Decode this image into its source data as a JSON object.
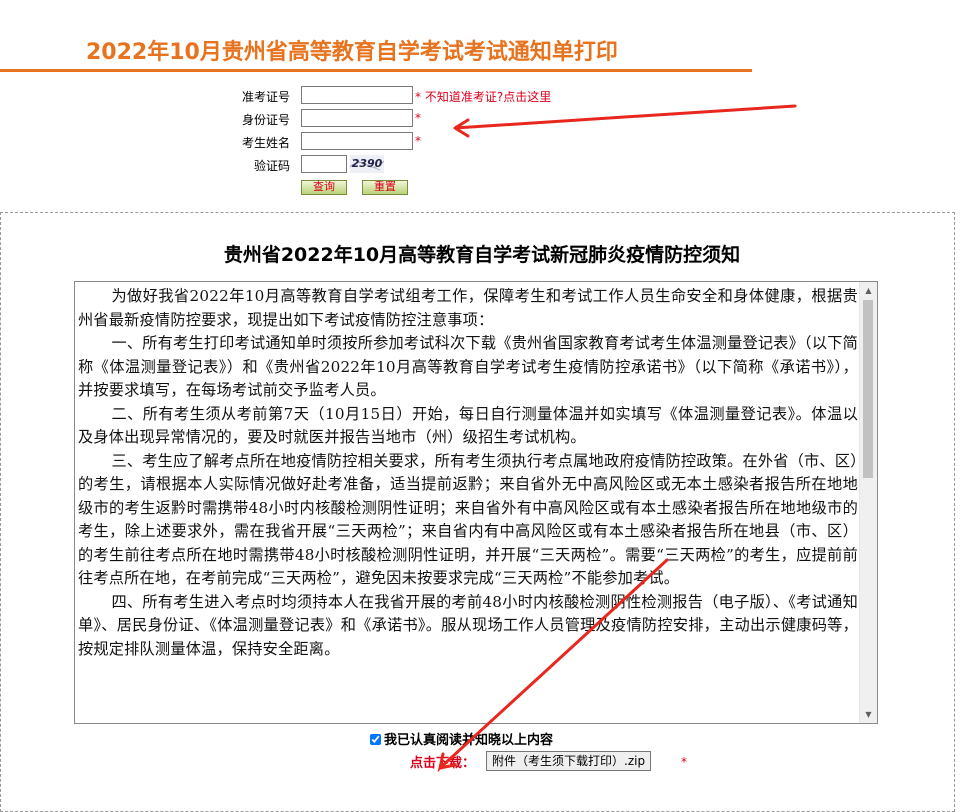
{
  "header": {
    "title": "2022年10月贵州省高等教育自学考试考试通知单打印"
  },
  "form": {
    "exam_id_label": "准考证号",
    "exam_id_hint_star": "*",
    "exam_id_hint_link": "不知道准考证?点击这里",
    "id_card_label": "身份证号",
    "id_card_star": "*",
    "name_label": "考生姓名",
    "name_star": "*",
    "captcha_label": "验证码",
    "captcha_code": "2390",
    "query_button": "查询",
    "reset_button": "重置"
  },
  "notice": {
    "title": "贵州省2022年10月高等教育自学考试新冠肺炎疫情防控须知",
    "paragraphs": [
      "为做好我省2022年10月高等教育自学考试组考工作，保障考生和考试工作人员生命安全和身体健康，根据贵州省最新疫情防控要求，现提出如下考试疫情防控注意事项：",
      "一、所有考生打印考试通知单时须按所参加考试科次下载《贵州省国家教育考试考生体温测量登记表》（以下简称《体温测量登记表》）和《贵州省2022年10月高等教育自学考试考生疫情防控承诺书》（以下简称《承诺书》），并按要求填写，在每场考试前交予监考人员。",
      "二、所有考生须从考前第7天（10月15日）开始，每日自行测量体温并如实填写《体温测量登记表》。体温以及身体出现异常情况的，要及时就医并报告当地市（州）级招生考试机构。",
      "三、考生应了解考点所在地疫情防控相关要求，所有考生须执行考点属地政府疫情防控政策。在外省（市、区）的考生，请根据本人实际情况做好赴考准备，适当提前返黔；来自省外无中高风险区或无本土感染者报告所在地地级市的考生返黔时需携带48小时内核酸检测阴性证明；来自省外有中高风险区或有本土感染者报告所在地地级市的考生，除上述要求外，需在我省开展“三天两检”；来自省内有中高风险区或有本土感染者报告所在地县（市、区）的考生前往考点所在地时需携带48小时核酸检测阴性证明，并开展“三天两检”。需要“三天两检”的考生，应提前前往考点所在地，在考前完成“三天两检”，避免因未按要求完成“三天两检”不能参加考试。",
      "四、所有考生进入考点时均须持本人在我省开展的考前48小时内核酸检测阴性检测报告（电子版）、《考试通知单》、居民身份证、《体温测量登记表》和《承诺书》。服从现场工作人员管理及疫情防控安排，主动出示健康码等，按规定排队测量体温，保持安全距离。"
    ]
  },
  "agreement": {
    "checkbox_label": "我已认真阅读并知晓以上内容",
    "checked": true
  },
  "download": {
    "label": "点击下载：",
    "button": "附件（考生须下载打印）.zip",
    "star": "*"
  },
  "colors": {
    "accent": "#e8731e",
    "required": "#d9001b",
    "arrow": "#e8281e"
  }
}
